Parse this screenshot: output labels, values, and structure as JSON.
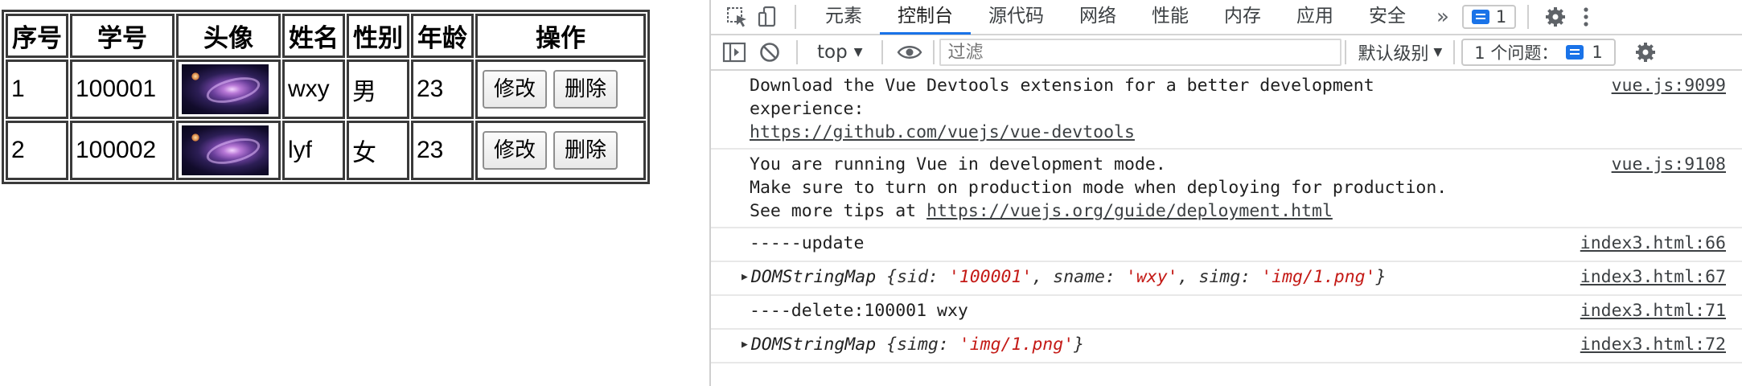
{
  "table": {
    "headers": [
      "序号",
      "学号",
      "头像",
      "姓名",
      "性别",
      "年龄",
      "操作"
    ],
    "rows": [
      {
        "index": "1",
        "sid": "100001",
        "name": "wxy",
        "sex": "男",
        "age": "23"
      },
      {
        "index": "2",
        "sid": "100002",
        "name": "lyf",
        "sex": "女",
        "age": "23"
      }
    ],
    "edit_label": "修改",
    "delete_label": "删除"
  },
  "devtools": {
    "tabs": [
      "元素",
      "控制台",
      "源代码",
      "网络",
      "性能",
      "内存",
      "应用",
      "安全"
    ],
    "active_tab": "控制台",
    "more_tabs": "»",
    "message_count": "1",
    "context": "top",
    "filter_placeholder": "过滤",
    "level": "默认级别",
    "issues_label": "1 个问题：",
    "issues_count": "1"
  },
  "console": {
    "logs": [
      {
        "text": "Download the Vue Devtools extension for a better development\nexperience:",
        "link": "https://github.com/vuejs/vue-devtools",
        "source": "vue.js:9099"
      },
      {
        "text": "You are running Vue in development mode.\nMake sure to turn on production mode when deploying for production.\nSee more tips at ",
        "link": "https://vuejs.org/guide/deployment.html",
        "source": "vue.js:9108"
      },
      {
        "text": "-----update",
        "source": "index3.html:66"
      },
      {
        "object": "DOMStringMap",
        "entries": [
          [
            "sid",
            "'100001'"
          ],
          [
            "sname",
            "'wxy'"
          ],
          [
            "simg",
            "'img/1.png'"
          ]
        ],
        "source": "index3.html:67"
      },
      {
        "text": "----delete:100001 wxy",
        "source": "index3.html:71"
      },
      {
        "object": "DOMStringMap",
        "entries": [
          [
            "simg",
            "'img/1.png'"
          ]
        ],
        "source": "index3.html:72"
      }
    ]
  }
}
